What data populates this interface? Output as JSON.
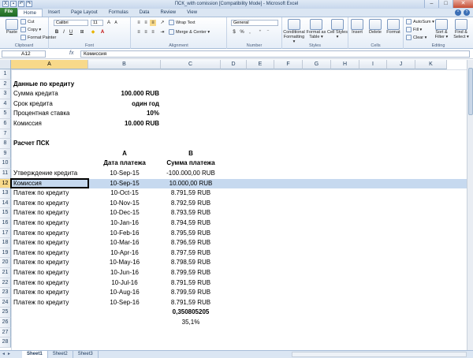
{
  "window": {
    "title": "ПСК_with comission  [Compatibility Mode]  -  Microsoft Excel",
    "minimize": "–",
    "maximize": "□",
    "close": "✕"
  },
  "ribbon_tabs": [
    "Home",
    "Insert",
    "Page Layout",
    "Formulas",
    "Data",
    "Review",
    "View"
  ],
  "file_tab": "File",
  "ribbon": {
    "clipboard": {
      "paste": "Paste",
      "cut": "Cut",
      "copy": "Copy ▾",
      "format_painter": "Format Painter",
      "label": "Clipboard"
    },
    "font": {
      "name": "Calibri",
      "size": "11",
      "label": "Font"
    },
    "alignment": {
      "wrap": "Wrap Text",
      "merge": "Merge & Center ▾",
      "label": "Alignment"
    },
    "number": {
      "format": "General",
      "label": "Number"
    },
    "styles": {
      "cond": "Conditional Formatting ▾",
      "table": "Format as Table ▾",
      "cell": "Cell Styles ▾",
      "label": "Styles"
    },
    "cells": {
      "insert": "Insert",
      "delete": "Delete",
      "format": "Format",
      "label": "Cells"
    },
    "editing": {
      "autosum": "AutoSum ▾",
      "fill": "Fill ▾",
      "clear": "Clear ▾",
      "sort": "Sort & Filter ▾",
      "find": "Find & Select ▾",
      "label": "Editing"
    }
  },
  "formula_bar": {
    "cell_ref": "A12",
    "fx": "fx",
    "content": "Комиссия"
  },
  "columns": [
    "A",
    "B",
    "C",
    "D",
    "E",
    "F",
    "G",
    "H",
    "I",
    "J",
    "K"
  ],
  "rows": [
    "1",
    "2",
    "3",
    "4",
    "5",
    "6",
    "7",
    "8",
    "9",
    "10",
    "11",
    "12",
    "13",
    "14",
    "15",
    "16",
    "17",
    "18",
    "19",
    "20",
    "21",
    "22",
    "23",
    "24",
    "25",
    "26",
    "27",
    "28"
  ],
  "sheet": {
    "r2_a": "Данные по кредиту",
    "r3_a": "Сумма кредита",
    "r3_b": "100.000 RUB",
    "r4_a": "Срок кредита",
    "r4_b": "один год",
    "r5_a": "Процентная ставка",
    "r5_b": "10%",
    "r6_a": "Комиссия",
    "r6_b": "10.000 RUB",
    "r8_a": "Расчет ПСК",
    "r9_b": "A",
    "r9_c": "B",
    "r10_b": "Дата платежа",
    "r10_c": "Сумма платежа",
    "payments": [
      {
        "a": "Утверждение кредита",
        "b": "10-Sep-15",
        "c": "-100.000,00 RUB"
      },
      {
        "a": "Комиссия",
        "b": "10-Sep-15",
        "c": "10.000,00 RUB"
      },
      {
        "a": "Платеж по кредиту",
        "b": "10-Oct-15",
        "c": "8.791,59 RUB"
      },
      {
        "a": "Платеж по кредиту",
        "b": "10-Nov-15",
        "c": "8.792,59 RUB"
      },
      {
        "a": "Платеж по кредиту",
        "b": "10-Dec-15",
        "c": "8.793,59 RUB"
      },
      {
        "a": "Платеж по кредиту",
        "b": "10-Jan-16",
        "c": "8.794,59 RUB"
      },
      {
        "a": "Платеж по кредиту",
        "b": "10-Feb-16",
        "c": "8.795,59 RUB"
      },
      {
        "a": "Платеж по кредиту",
        "b": "10-Mar-16",
        "c": "8.796,59 RUB"
      },
      {
        "a": "Платеж по кредиту",
        "b": "10-Apr-16",
        "c": "8.797,59 RUB"
      },
      {
        "a": "Платеж по кредиту",
        "b": "10-May-16",
        "c": "8.798,59 RUB"
      },
      {
        "a": "Платеж по кредиту",
        "b": "10-Jun-16",
        "c": "8.799,59 RUB"
      },
      {
        "a": "Платеж по кредиту",
        "b": "10-Jul-16",
        "c": "8.791,59 RUB"
      },
      {
        "a": "Платеж по кредиту",
        "b": "10-Aug-16",
        "c": "8.799,59 RUB"
      },
      {
        "a": "Платеж по кредиту",
        "b": "10-Sep-16",
        "c": "8.791,59 RUB"
      }
    ],
    "r25_c": "0,350805205",
    "r26_c": "35,1%"
  },
  "sheet_tabs": [
    "Sheet1",
    "Sheet2",
    "Sheet3"
  ]
}
